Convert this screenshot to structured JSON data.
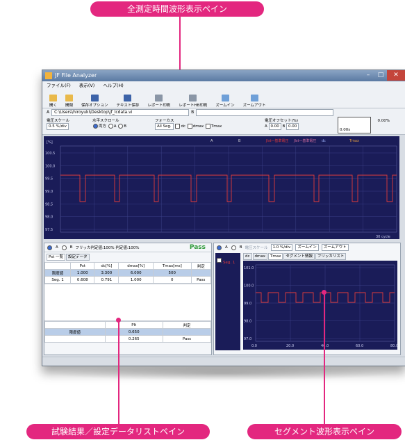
{
  "callouts": {
    "top": "全測定時間波形表示ペイン",
    "bottom_left": "試験結果／設定データリストペイン",
    "bottom_right": "セグメント波形表示ペイン"
  },
  "window": {
    "title": "JF File Analyzer",
    "menu": [
      "ファイル(F)",
      "表示(V)",
      "ヘルプ(H)"
    ],
    "toolbar": [
      "開く",
      "開閉",
      "保存オプション",
      "テキスト保存",
      "レポート印刷",
      "レポートHB印刷",
      "ズームイン",
      "ズームアウト"
    ],
    "path": "C:\\Users\\hiroyuki\\Desktop\\jf_lcdata.vi",
    "voltage_scale_label": "電圧スケール",
    "voltage_scale_value": "0.5 %/div",
    "hscroll_label": "水平スクロール",
    "hscroll_opts": [
      "両方",
      "A",
      "B"
    ],
    "focus_label": "フォーカス",
    "focus_value": "All Seg.",
    "checks": [
      "dc",
      "dmax",
      "Tmax"
    ],
    "offset_label": "電圧オフセット(%)",
    "offset_a": "0.00",
    "offset_b": "0.00",
    "offset_a_lbl": "A",
    "offset_b_lbl": "B",
    "scale_box_top": "0.00%",
    "scale_box_bottom": "0.00s"
  },
  "main_plot": {
    "y_unit": "[%]",
    "yticks": [
      "100.5",
      "100.0",
      "99.5",
      "99.0",
      "98.5",
      "98.0",
      "97.5"
    ],
    "legend": [
      "A",
      "B",
      "Jlst—基準電圧",
      "Jlst—基準電圧",
      "dc",
      "Tmax"
    ],
    "xlabel": "30 cycle"
  },
  "result_panel": {
    "radio_a": "A",
    "radio_b": "B",
    "flicker_info": "フリッカ判定値:100%  判定値:100%",
    "pass": "Pass",
    "tabs": [
      "Pst 一覧",
      "設定データ"
    ],
    "headers": [
      "",
      "Pst",
      "dc[%]",
      "dmax[%]",
      "Tmax[ms]",
      "判定"
    ],
    "rows": [
      [
        "限度値",
        "1.000",
        "3.300",
        "6.000",
        "500",
        ""
      ],
      [
        "Seg. 1",
        "0.608",
        "0.791",
        "1.000",
        "0",
        "Pass"
      ]
    ],
    "bottom_headers": [
      "",
      "Plt",
      "判定"
    ],
    "bottom_rows": [
      [
        "限度値",
        "0.650",
        ""
      ],
      [
        "",
        "0.265",
        "Pass"
      ]
    ]
  },
  "segment_panel": {
    "scale_label": "電圧スケール",
    "scale_value": "1.0 %/div",
    "zoom_in": "ズームイン",
    "zoom_out": "ズームアウト",
    "seg_item": "Seg. 1",
    "tabs": [
      "dc",
      "dmax",
      "Tmax",
      "セグメント情報",
      "フリッカリスト"
    ],
    "yticks": [
      "101.0",
      "100.0",
      "99.0",
      "98.0",
      "97.0"
    ],
    "xticks": [
      "0.0",
      "20.0",
      "40.0",
      "60.0",
      "80.0"
    ]
  },
  "colors": {
    "callout": "#e3277f",
    "plot_bg": "#1a1c58",
    "trace": "#e23b3b",
    "pass_green": "#2f9a3a"
  }
}
